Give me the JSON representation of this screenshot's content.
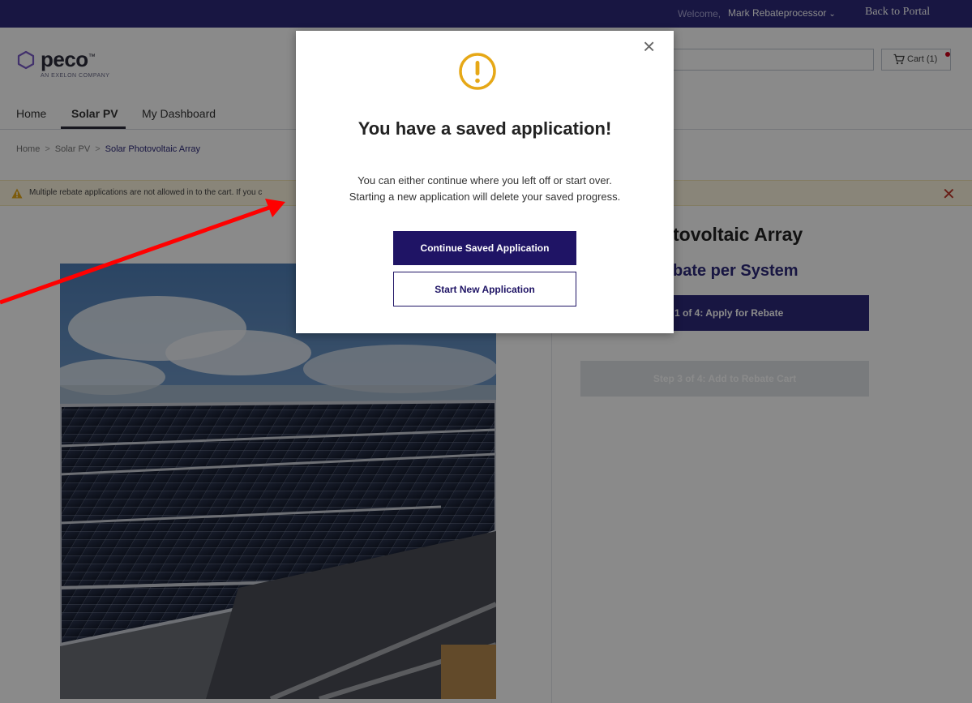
{
  "topbar": {
    "welcome": "Welcome,",
    "user_name": "Mark Rebateprocessor",
    "back_to_portal": "Back to Portal"
  },
  "header": {
    "logo_text": "peco",
    "logo_tm": "™",
    "logo_sub": "AN EXELON COMPANY",
    "cart_label": "Cart (1)"
  },
  "nav": {
    "items": [
      {
        "label": "Home"
      },
      {
        "label": "Solar PV"
      },
      {
        "label": "My Dashboard"
      }
    ]
  },
  "breadcrumb": {
    "items": [
      "Home",
      "Solar PV",
      "Solar Photovoltaic Array"
    ],
    "separator": ">"
  },
  "alert": {
    "message": "Multiple rebate applications are not allowed in to the cart. If you c",
    "close": "✕"
  },
  "product": {
    "title_partial": "tovoltaic Array",
    "subtitle_partial": "bate per System",
    "step1_partial": "1 of 4: Apply for Rebate",
    "step3": "Step 3 of 4: Add to Rebate Cart"
  },
  "modal": {
    "close": "×",
    "title": "You have a saved application!",
    "body_line1": "You can either continue where you left off or start over.",
    "body_line2": "Starting a new application will delete your saved progress.",
    "continue_button": "Continue Saved Application",
    "start_new_button": "Start New Application"
  },
  "colors": {
    "brand_navy": "#2e2a7a",
    "button_navy": "#1f1465",
    "alert_bg": "#fdf6e0",
    "warning_icon": "#e6a817",
    "annotation_arrow": "#ff0000"
  },
  "icons": [
    "chevron-down-icon",
    "cart-icon",
    "warning-icon",
    "close-icon",
    "exclamation-circle-icon",
    "arrow-annotation"
  ]
}
